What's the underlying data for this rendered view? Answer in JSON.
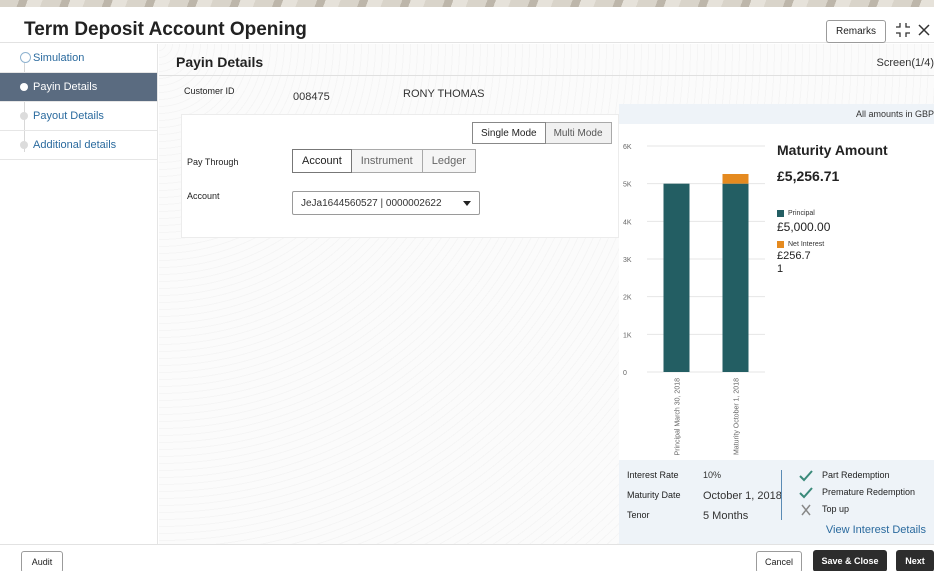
{
  "header": {
    "title": "Term Deposit Account Opening",
    "remarks_label": "Remarks"
  },
  "sidebar": {
    "items": [
      {
        "label": "Simulation",
        "state": "done"
      },
      {
        "label": "Payin Details",
        "state": "active"
      },
      {
        "label": "Payout Details",
        "state": "pending"
      },
      {
        "label": "Additional details",
        "state": "pending"
      }
    ]
  },
  "main": {
    "section_title": "Payin Details",
    "screen_indicator": "Screen(1/4)",
    "customer": {
      "id_label": "Customer ID",
      "id_value": "008475",
      "name": "RONY THOMAS"
    },
    "modes": [
      "Single Mode",
      "Multi Mode"
    ],
    "pay_through": {
      "label": "Pay Through",
      "options": [
        "Account",
        "Instrument",
        "Ledger"
      ]
    },
    "account": {
      "label": "Account",
      "value": "JeJa1644560527 | 0000002622"
    }
  },
  "summary": {
    "amounts_note": "All amounts in GBP",
    "maturity_title": "Maturity Amount",
    "maturity_amount": "£5,256.71",
    "principal_label": "Principal",
    "principal_value": "£5,000.00",
    "interest_label": "Net Interest",
    "interest_value_line1": "£256.7",
    "interest_value_line2": "1",
    "interest_rate_label": "Interest Rate",
    "interest_rate_value": "10%",
    "maturity_date_label": "Maturity Date",
    "maturity_date_value": "October 1, 2018",
    "tenor_label": "Tenor",
    "tenor_value": "5 Months",
    "features": [
      {
        "label": "Part Redemption",
        "icon": "check-icon"
      },
      {
        "label": "Premature Redemption",
        "icon": "check-icon"
      },
      {
        "label": "Top up",
        "icon": "cross-icon"
      }
    ],
    "view_link": "View Interest Details"
  },
  "chart_data": {
    "type": "bar",
    "stacked": true,
    "categories": [
      "Principal March 30, 2018",
      "Maturity October 1, 2018"
    ],
    "series": [
      {
        "name": "Principal",
        "values": [
          5000,
          5000
        ],
        "color": "#235e63"
      },
      {
        "name": "Net Interest",
        "values": [
          0,
          256.71
        ],
        "color": "#e58a1f"
      }
    ],
    "ylim": [
      0,
      6000
    ],
    "yticks": [
      "0",
      "1K",
      "2K",
      "3K",
      "4K",
      "5K",
      "6K"
    ],
    "grid": true
  },
  "colors": {
    "active_nav": "#5a6b80",
    "link": "#2a6a9e",
    "principal": "#235e63",
    "interest": "#e58a1f",
    "check": "#3a8a7a",
    "dark_button": "#2d2d2d"
  },
  "footer": {
    "audit_label": "Audit",
    "cancel_label": "Cancel",
    "save_close_label": "Save & Close",
    "next_label": "Next"
  }
}
